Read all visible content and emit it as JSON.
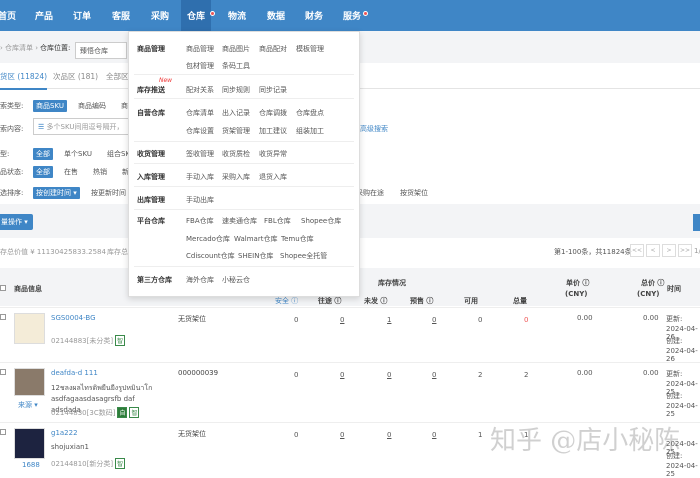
{
  "nav": [
    {
      "label": "首页"
    },
    {
      "label": "产品"
    },
    {
      "label": "订单"
    },
    {
      "label": "客服"
    },
    {
      "label": "采购"
    },
    {
      "label": "仓库",
      "active": true,
      "dot": true
    },
    {
      "label": "物流"
    },
    {
      "label": "数据"
    },
    {
      "label": "财务"
    },
    {
      "label": "服务",
      "dot": true
    }
  ],
  "colors": {
    "brand": "#3f86c6",
    "badge": "#2e7d3a",
    "alert": "#e55555"
  },
  "breadcrumb": {
    "path": "› 仓库清单 ›",
    "location_label": "仓库位置:",
    "location_value": "臻悟仓库"
  },
  "tabs": [
    {
      "label": "货区 (11824)",
      "active": true
    },
    {
      "label": "次品区 (181)"
    },
    {
      "label": "全部区"
    }
  ],
  "filters": {
    "search_type": {
      "label": "索类型:",
      "options": [
        "商品SKU",
        "商品编码",
        "商"
      ]
    },
    "search_content": {
      "label": "索内容:",
      "placeholder": "多个SKU间用逗号隔开，",
      "advanced": "高级搜索"
    },
    "type": {
      "label": "型:",
      "options": [
        "全部",
        "单个SKU",
        "组合SK"
      ]
    },
    "status": {
      "label": "品状态:",
      "options": [
        "全部",
        "在售",
        "热销",
        "新"
      ]
    },
    "sort": {
      "label": "选排序:",
      "options": [
        "按创建时间 ▾",
        "按更新时间",
        "采购在途",
        "按货架位"
      ]
    }
  },
  "bulk_button": "量操作 ▾",
  "stats": {
    "total_value": "存总价值 ¥ 11130425833.2584",
    "total_stock": "库存总"
  },
  "pagination": {
    "summary": "第1-100条，共11824条",
    "buttons": [
      "<<",
      "<",
      ">",
      ">>"
    ],
    "page": "1/"
  },
  "table": {
    "headers": {
      "product": "商品信息",
      "stock": "库存情况",
      "safe": "安全 ⓘ",
      "transit": "往途 ⓘ",
      "unshipped": "未发 ⓘ",
      "presale": "预售 ⓘ",
      "available": "可用",
      "total": "总量",
      "unit_price": "单价 ⓘ",
      "unit_price_cur": "(CNY)",
      "total_price": "总价 ⓘ",
      "total_price_cur": "(CNY)",
      "time": "时间"
    },
    "rows": [
      {
        "sku": "SGS0004-BG",
        "name": "",
        "code": "02144883[未分类]",
        "badges": [
          "智"
        ],
        "source": "",
        "shelf": "无货架位",
        "safe": "0",
        "transit": "0",
        "unshipped": "1",
        "presale": "0",
        "available": "0",
        "total": "0",
        "unit_price": "0.00",
        "total_price": "0.00",
        "updated_label": "更新:",
        "updated": "2024-04-26",
        "created_label": "创建:",
        "created": "2024-04-26"
      },
      {
        "sku": "deafda-d 111",
        "name": "12ชลงผลไทรดิพยืนยีงรูปหมินาโก asdfagaasdasagrsfb daf adsdada",
        "code": "02144830[3C数码]",
        "badges": [
          "自",
          "智"
        ],
        "source": "来源 ▾",
        "shelf": "000000039",
        "safe": "0",
        "transit": "0",
        "unshipped": "0",
        "presale": "0",
        "available": "2",
        "total": "2",
        "unit_price": "0.00",
        "total_price": "0.00",
        "updated_label": "更新:",
        "updated": "2024-04-25",
        "created_label": "创建:",
        "created": "2024-04-25"
      },
      {
        "sku": "g1a222",
        "name": "shojuxian1",
        "code": "02144810[新分类]",
        "badges": [
          "智"
        ],
        "source": "1688",
        "shelf": "无货架位",
        "safe": "0",
        "transit": "0",
        "unshipped": "0",
        "presale": "0",
        "available": "1",
        "total": "1",
        "unit_price": "",
        "total_price": "",
        "updated_label": "",
        "updated": "2024-04-25",
        "created_label": "创建:",
        "created": "2024-04-25"
      }
    ]
  },
  "dropdown": {
    "sections": [
      {
        "title": "商品管理",
        "items": [
          "商品管理",
          "商品图片",
          "商品配对",
          "模板管理",
          "包材管理",
          "条码工具"
        ]
      },
      {
        "title": "库存推送",
        "tag": "New",
        "items": [
          "配对关系",
          "同步规则",
          "同步记录"
        ]
      },
      {
        "title": "自营仓库",
        "items": [
          "仓库清单",
          "出入记录",
          "仓库调拨",
          "仓库盘点",
          "仓库设置",
          "货架管理",
          "加工建议",
          "组装加工"
        ]
      },
      {
        "title": "收货管理",
        "items": [
          "签收管理",
          "收货质检",
          "收货异常"
        ]
      },
      {
        "title": "入库管理",
        "items": [
          "手动入库",
          "采购入库",
          "退货入库"
        ]
      },
      {
        "title": "出库管理",
        "items": [
          "手动出库"
        ]
      },
      {
        "title": "平台仓库",
        "items": [
          "FBA仓库",
          "速卖通仓库",
          "FBL仓库",
          "Shopee仓库",
          "Mercado仓库",
          "Walmart仓库",
          "Temu仓库",
          "Cdiscount仓库",
          "SHEIN仓库",
          "Shopee全托管"
        ]
      },
      {
        "title": "第三方仓库",
        "items": [
          "海外仓库",
          "小秘云仓"
        ]
      }
    ]
  },
  "watermark": "知乎 @店小秘陈"
}
